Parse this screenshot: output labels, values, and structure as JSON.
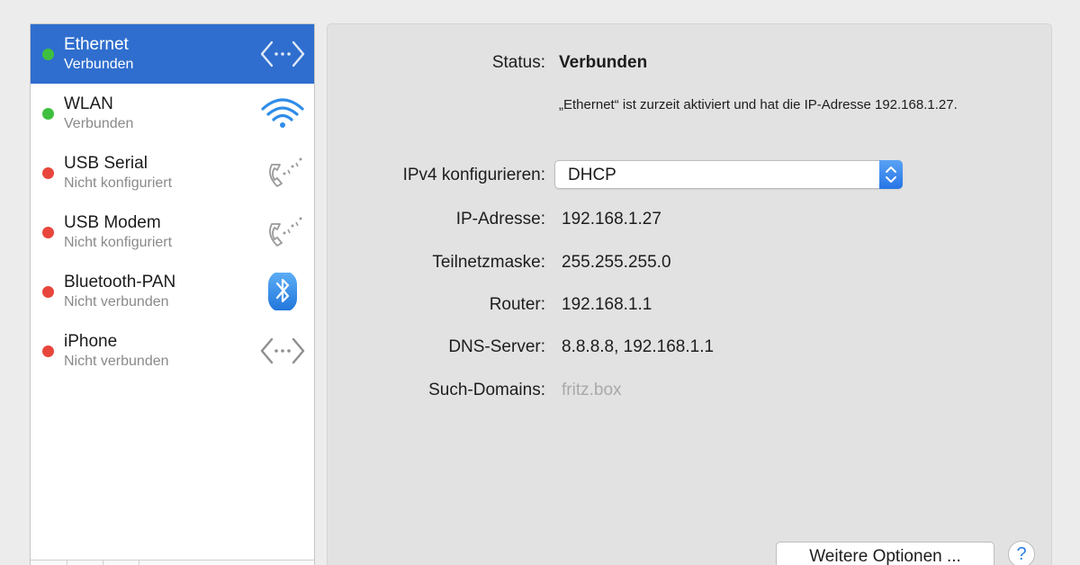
{
  "sidebar": {
    "services": [
      {
        "name": "Ethernet",
        "status": "Verbunden",
        "state": "green",
        "icon": "ethernet-icon"
      },
      {
        "name": "WLAN",
        "status": "Verbunden",
        "state": "green",
        "icon": "wifi-icon"
      },
      {
        "name": "USB Serial",
        "status": "Nicht konfiguriert",
        "state": "red",
        "icon": "phone-icon"
      },
      {
        "name": "USB Modem",
        "status": "Nicht konfiguriert",
        "state": "red",
        "icon": "phone-icon"
      },
      {
        "name": "Bluetooth-PAN",
        "status": "Nicht verbunden",
        "state": "red",
        "icon": "bluetooth-icon"
      },
      {
        "name": "iPhone",
        "status": "Nicht verbunden",
        "state": "red",
        "icon": "ethernet-icon"
      }
    ],
    "selected": "Ethernet"
  },
  "detail": {
    "status_label": "Status:",
    "status_value": "Verbunden",
    "status_description": "„Ethernet“ ist zurzeit aktiviert und hat die IP-Adresse 192.168.1.27.",
    "ipv4_label": "IPv4 konfigurieren:",
    "ipv4_value": "DHCP",
    "ip_label": "IP-Adresse:",
    "ip_value": "192.168.1.27",
    "subnet_label": "Teilnetzmaske:",
    "subnet_value": "255.255.255.0",
    "router_label": "Router:",
    "router_value": "192.168.1.1",
    "dns_label": "DNS-Server:",
    "dns_value": "8.8.8.8, 192.168.1.1",
    "search_label": "Such-Domains:",
    "search_value": "fritz.box",
    "more_button": "Weitere Optionen ...",
    "help_button": "?"
  },
  "colors": {
    "selection": "#2f6ece",
    "connected": "#3fbf3f",
    "disconnected": "#e8463c",
    "accent": "#2675e6"
  }
}
